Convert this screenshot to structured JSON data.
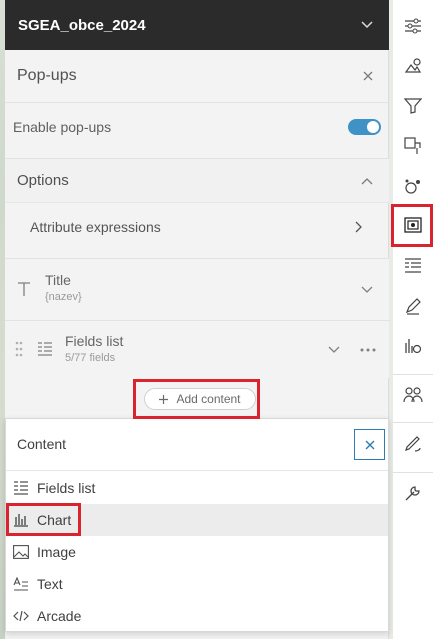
{
  "layer": {
    "title": "SGEA_obce_2024"
  },
  "popups": {
    "title": "Pop-ups",
    "enable_label": "Enable pop-ups",
    "enabled": true
  },
  "options": {
    "title": "Options",
    "attribute_expressions": "Attribute expressions"
  },
  "elements": [
    {
      "name": "Title",
      "detail": "{nazev}"
    },
    {
      "name": "Fields list",
      "detail": "5/77 fields"
    }
  ],
  "add_content": {
    "label": "Add content"
  },
  "content_menu": {
    "title": "Content",
    "items": [
      {
        "label": "Fields list",
        "icon": "fields-list-icon"
      },
      {
        "label": "Chart",
        "icon": "chart-icon"
      },
      {
        "label": "Image",
        "icon": "image-icon"
      },
      {
        "label": "Text",
        "icon": "text-icon"
      },
      {
        "label": "Arcade",
        "icon": "arcade-icon"
      }
    ]
  },
  "right_rail": {
    "icons": [
      "properties-icon",
      "styles-icon",
      "filter-icon",
      "effects-icon",
      "aggregation-icon",
      "popups-icon",
      "fields-icon",
      "labels-icon",
      "charts-icon",
      "sharing-icon",
      "sketch-icon",
      "configure-icon"
    ],
    "active": "popups-icon"
  },
  "colors": {
    "accent": "#3e92c6",
    "highlight": "#d9232e",
    "header_bg": "#2b2b2b"
  }
}
